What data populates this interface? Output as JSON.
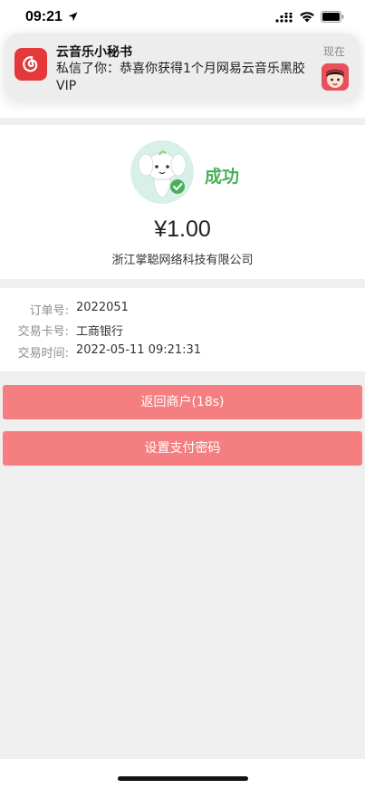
{
  "status_bar": {
    "time": "09:21"
  },
  "notification": {
    "app_name": "云音乐小秘书",
    "message": "私信了你：恭喜你获得1个月网易云音乐黑胶 VIP",
    "time": "现在"
  },
  "payment": {
    "status": "成功",
    "amount": "¥1.00",
    "merchant": "浙江掌聪网络科技有限公司"
  },
  "details": [
    {
      "label": "订单号:",
      "value": "2022051"
    },
    {
      "label": "交易卡号:",
      "value": "工商银行"
    },
    {
      "label": "交易时间:",
      "value": "2022-05-11 09:21:31"
    }
  ],
  "buttons": {
    "return_label": "返回商户(18s)",
    "set_password_label": "设置支付密码"
  },
  "colors": {
    "button": "#f57f80",
    "success": "#4cae5a",
    "app_icon": "#e5383b"
  }
}
